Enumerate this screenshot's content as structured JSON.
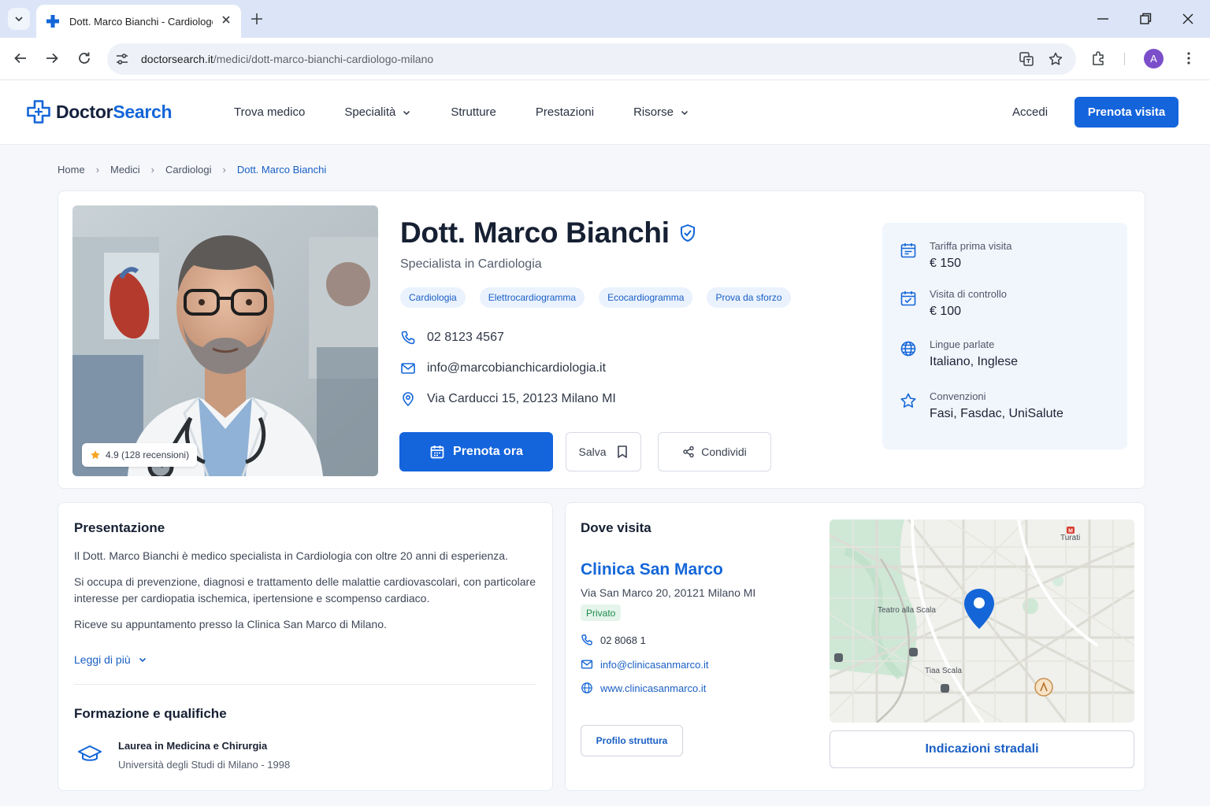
{
  "browser": {
    "tab_title": "Dott. Marco Bianchi - Cardiologo",
    "url_domain": "doctorsearch.it",
    "url_path": "/medici/dott-marco-bianchi-cardiologo-milano",
    "avatar_letter": "A"
  },
  "header": {
    "logo_part1": "Doctor",
    "logo_part2": "Search",
    "nav": [
      {
        "label": "Trova medico",
        "has_dropdown": false
      },
      {
        "label": "Specialità",
        "has_dropdown": true
      },
      {
        "label": "Strutture",
        "has_dropdown": false
      },
      {
        "label": "Prestazioni",
        "has_dropdown": false
      },
      {
        "label": "Risorse",
        "has_dropdown": true
      }
    ],
    "login": "Accedi",
    "cta": "Prenota visita"
  },
  "breadcrumb": [
    "Home",
    "Medici",
    "Cardiologi",
    "Dott. Marco Bianchi"
  ],
  "doctor": {
    "name": "Dott. Marco Bianchi",
    "specialty": "Specialista in Cardiologia",
    "rating": "4.9 (128 recensioni)",
    "tags": [
      "Cardiologia",
      "Elettrocardiogramma",
      "Ecocardiogramma",
      "Prova da sforzo"
    ],
    "phone": "02 8123 4567",
    "email": "info@marcobianchicardiologia.it",
    "address": "Via Carducci 15, 20123 Milano MI",
    "book_label": "Prenota ora",
    "save_label": "Salva",
    "share_label": "Condividi"
  },
  "info_panel": [
    {
      "label": "Tariffa prima visita",
      "value": "€ 150",
      "icon": "calendar-fee-icon"
    },
    {
      "label": "Visita di controllo",
      "value": "€ 100",
      "icon": "calendar-check-icon"
    },
    {
      "label": "Lingue parlate",
      "value": "Italiano, Inglese",
      "icon": "globe-icon"
    },
    {
      "label": "Convenzioni",
      "value": "Fasi, Fasdac, UniSalute",
      "icon": "star-outline-icon"
    }
  ],
  "presentation": {
    "title": "Presentazione",
    "paragraphs": [
      "Il Dott. Marco Bianchi è medico specialista in Cardiologia con oltre 20 anni di esperienza.",
      "Si occupa di prevenzione, diagnosi e trattamento delle malattie cardiovascolari, con particolare interesse per cardiopatia ischemica, ipertensione e scompenso cardiaco.",
      "Riceve su appuntamento presso la Clinica San Marco di Milano."
    ],
    "read_more": "Leggi di più"
  },
  "education": {
    "title": "Formazione e qualifiche",
    "degree": "Laurea in Medicina e Chirurgia",
    "university": "Università degli Studi di Milano - 1998"
  },
  "location": {
    "title": "Dove visita",
    "clinic_name": "Clinica San Marco",
    "address": "Via San Marco 20, 20121 Milano MI",
    "badge": "Privato",
    "phone": "02 8068 1",
    "email": "info@clinicasanmarco.it",
    "website": "www.clinicasanmarco.it",
    "profile_button": "Profilo struttura",
    "directions_button": "Indicazioni stradali",
    "map_labels": {
      "turati": "Turati",
      "teatro": "Teatro alla Scala",
      "tlaa": "Tiaa Scala"
    }
  },
  "colors": {
    "primary": "#1464dc",
    "accent_text": "#1a5fc4",
    "badge_green": "#1f8a4c"
  }
}
